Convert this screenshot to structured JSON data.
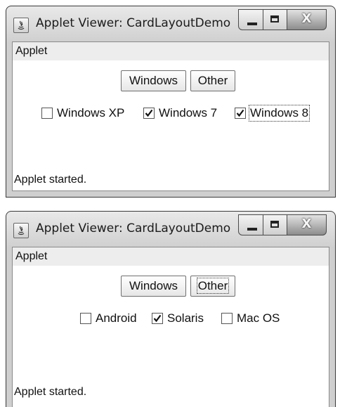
{
  "windows": [
    {
      "title": "Applet Viewer: CardLayoutDemo",
      "menu": "Applet",
      "buttons": [
        "Windows",
        "Other"
      ],
      "focused_button": "",
      "checkboxes": [
        {
          "label": "Windows XP",
          "checked": false
        },
        {
          "label": "Windows 7",
          "checked": true
        },
        {
          "label": "Windows 8",
          "checked": true
        }
      ],
      "status": "Applet started."
    },
    {
      "title": "Applet Viewer: CardLayoutDemo",
      "menu": "Applet",
      "buttons": [
        "Windows",
        "Other"
      ],
      "focused_button": "Other",
      "checkboxes": [
        {
          "label": "Android",
          "checked": false
        },
        {
          "label": "Solaris",
          "checked": true
        },
        {
          "label": "Mac OS",
          "checked": false
        }
      ],
      "status": "Applet started."
    }
  ],
  "controls": {
    "close_glyph": "X"
  },
  "icons": [
    "java-applet-icon",
    "minimize-icon",
    "maximize-icon",
    "close-icon",
    "checkmark-icon"
  ]
}
